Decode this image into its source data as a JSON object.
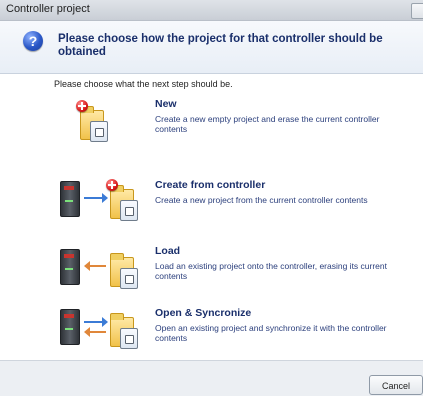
{
  "window": {
    "title": "Controller project"
  },
  "header": {
    "title": "Please choose how the project for that controller should be obtained"
  },
  "content": {
    "instruction": "Please choose what the next step should be."
  },
  "options": [
    {
      "title": "New",
      "description": "Create a new empty project and erase the current controller contents"
    },
    {
      "title": "Create from controller",
      "description": "Create a new project from the current controller contents"
    },
    {
      "title": "Load",
      "description": "Load an existing project onto the controller, erasing its current contents"
    },
    {
      "title": "Open & Syncronize",
      "description": "Open an existing project and synchronize it with the controller contents"
    }
  ],
  "footer": {
    "cancel_label": "Cancel"
  },
  "icons": {
    "dialog_icon": "question-icon",
    "new": "new-project-icon",
    "create_from_controller": "controller-to-project-icon",
    "load": "project-to-controller-icon",
    "open_sync": "sync-project-icon"
  },
  "colors": {
    "header_title": "#1a2f6b",
    "link_text": "#2b3f7c",
    "accent_blue": "#3b7bd6",
    "accent_orange": "#e0873a",
    "accent_red": "#d81b1b"
  }
}
